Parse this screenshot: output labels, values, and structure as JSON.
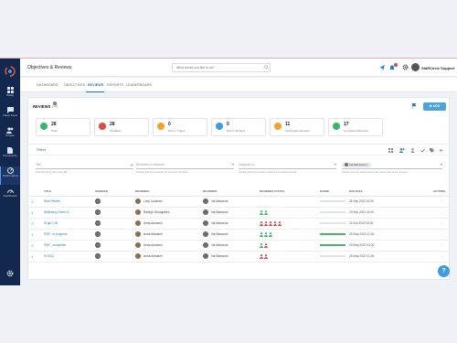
{
  "app": {
    "title": "Objectives & Reviews",
    "user": "StaffCircle Support",
    "notification_count": "1"
  },
  "search": {
    "placeholder": "What would you like to do?"
  },
  "sidebar": [
    {
      "label": "Today",
      "icon": "grid-icon"
    },
    {
      "label": "News Feed",
      "icon": "chat-icon"
    },
    {
      "label": "People",
      "icon": "people-icon"
    },
    {
      "label": "Documents",
      "icon": "document-icon"
    },
    {
      "label": "Performance",
      "icon": "performance-icon"
    },
    {
      "label": "Dashboard",
      "icon": "dashboard-icon"
    }
  ],
  "tabs": [
    "DASHBOARD",
    "OBJECTIVES",
    "REVIEWS",
    "REPORTS",
    "LEADERBOARD"
  ],
  "active_tab": "REVIEWS",
  "reviews": {
    "title": "REVIEWS",
    "count": "(28)",
    "add_label": "ADD"
  },
  "stats": [
    {
      "value": "28",
      "label": "Total",
      "color": "#3bb26a"
    },
    {
      "value": "28",
      "label": "Outdated",
      "color": "#e04848"
    },
    {
      "value": "0",
      "label": "Due in 7 days",
      "color": "#f0a22e"
    },
    {
      "value": "0",
      "label": "Due in 30 days",
      "color": "#3d9be0"
    },
    {
      "value": "11",
      "label": "Incomplete Reviews",
      "color": "#f0a22e"
    },
    {
      "value": "17",
      "label": "Completed Reviews",
      "color": "#3bb26a"
    }
  ],
  "filters": {
    "title": "Filters",
    "title_input": "Title",
    "reviewee_input": "Reviewer or reviewee...",
    "assigned_input": "Assigned to...",
    "selected_chip": "Val Manwood",
    "title_help": "Filter the list by the review title",
    "reviewee_help": "Include only those reviews for a certain individual",
    "assigned_help": "Include only those reviews assigned to selected people",
    "selected_help": "Include only the reviews where the current user is the reviewer"
  },
  "columns": [
    "TITLE",
    "OVERDUE",
    "REVIEWEE",
    "REVIEWER",
    "REVIEWEE STATUS",
    "SCORE",
    "DUE DATE",
    "ACTIONS"
  ],
  "rows": [
    {
      "title": "Role Review",
      "reviewee": "Lucy Lockman",
      "reviewer": "Val Marwood",
      "status": "",
      "progress": 0,
      "due": "26 Sep 2022 01:00"
    },
    {
      "title": "Wellbeing Check In",
      "reviewee": "Raleigh Georgiades",
      "reviewer": "Val Marwood",
      "status": "green-green",
      "progress": 0,
      "due": "19 Sep 2022 01:00"
    },
    {
      "title": "Hi girl 1:30",
      "reviewee": "Anna Antusem",
      "reviewer": "Val Marwood",
      "status": "red-many",
      "progress": 0,
      "due": "22 Jun 2022 09:00"
    },
    {
      "title": "PDR - in progress",
      "reviewee": "Anna Antusem",
      "reviewer": "Val Marwood",
      "status": "green-green-green",
      "progress": 1,
      "due": "25 May 2022 01:00"
    },
    {
      "title": "PDR - completed",
      "reviewee": "Anna Antusem",
      "reviewer": "Val Marwood",
      "status": "green-red",
      "progress": 1,
      "due": "25 May 2022 01:00"
    },
    {
      "title": "Hi SDQ",
      "reviewee": "Anna Antusem",
      "reviewer": "Val Marwood",
      "status": "red-red",
      "progress": 0,
      "due": "25 May 2022 01:00"
    }
  ]
}
